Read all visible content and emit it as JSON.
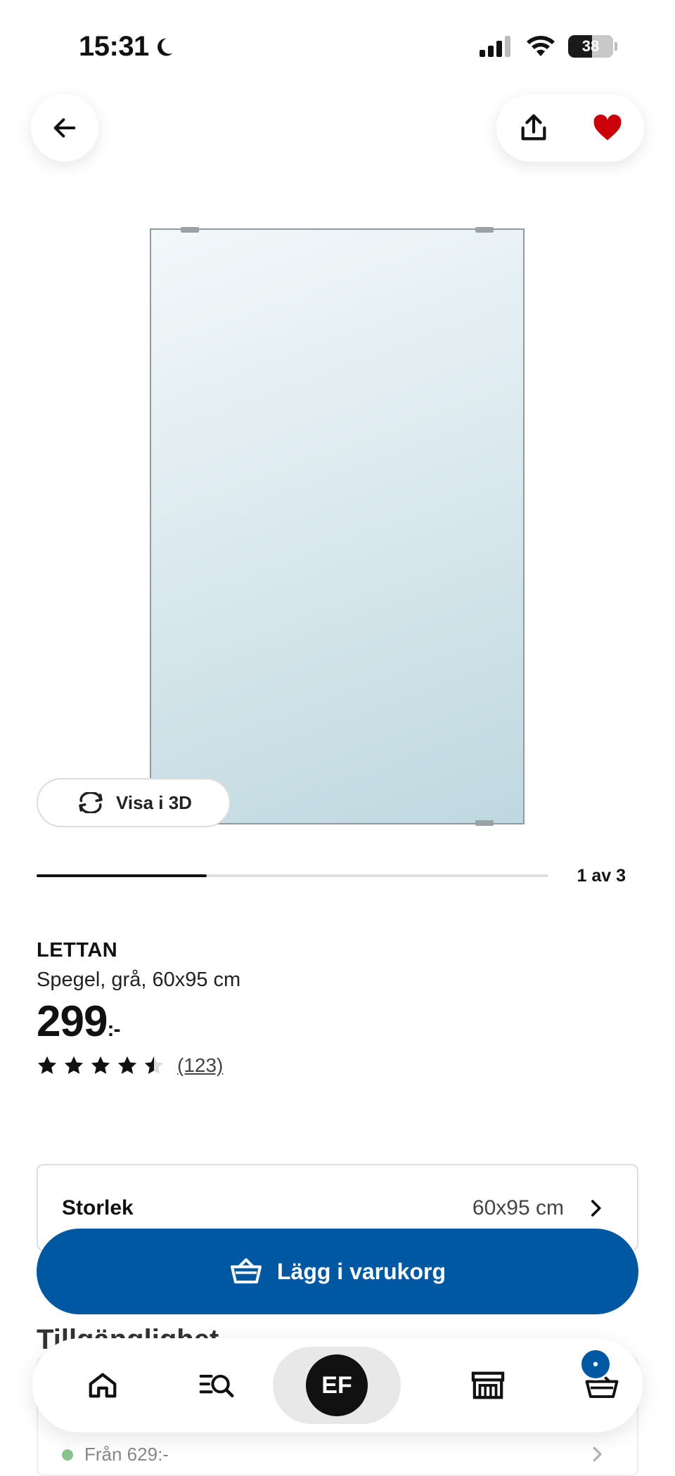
{
  "status_bar": {
    "time": "15:31",
    "battery": "38"
  },
  "product": {
    "name": "LETTAN",
    "description": "Spegel, grå, 60x95 cm",
    "price": "299",
    "price_suffix": ":-",
    "rating": 4.5,
    "rating_count": "(123)"
  },
  "gallery": {
    "view_3d_label": "Visa i 3D",
    "position_label": "1 av 3",
    "progress_fraction": 0.333
  },
  "size_selector": {
    "label": "Storlek",
    "value": "60x95 cm"
  },
  "add_to_cart": {
    "label": "Lägg i varukorg"
  },
  "availability": {
    "title": "Tillgänglighet",
    "from_price": "Från 629:-"
  },
  "bottom_nav": {
    "profile_initials": "EF",
    "cart_badge": "•"
  },
  "colors": {
    "brand_blue": "#0058a3",
    "favorite_red": "#cc0008",
    "text_dark": "#111111"
  }
}
